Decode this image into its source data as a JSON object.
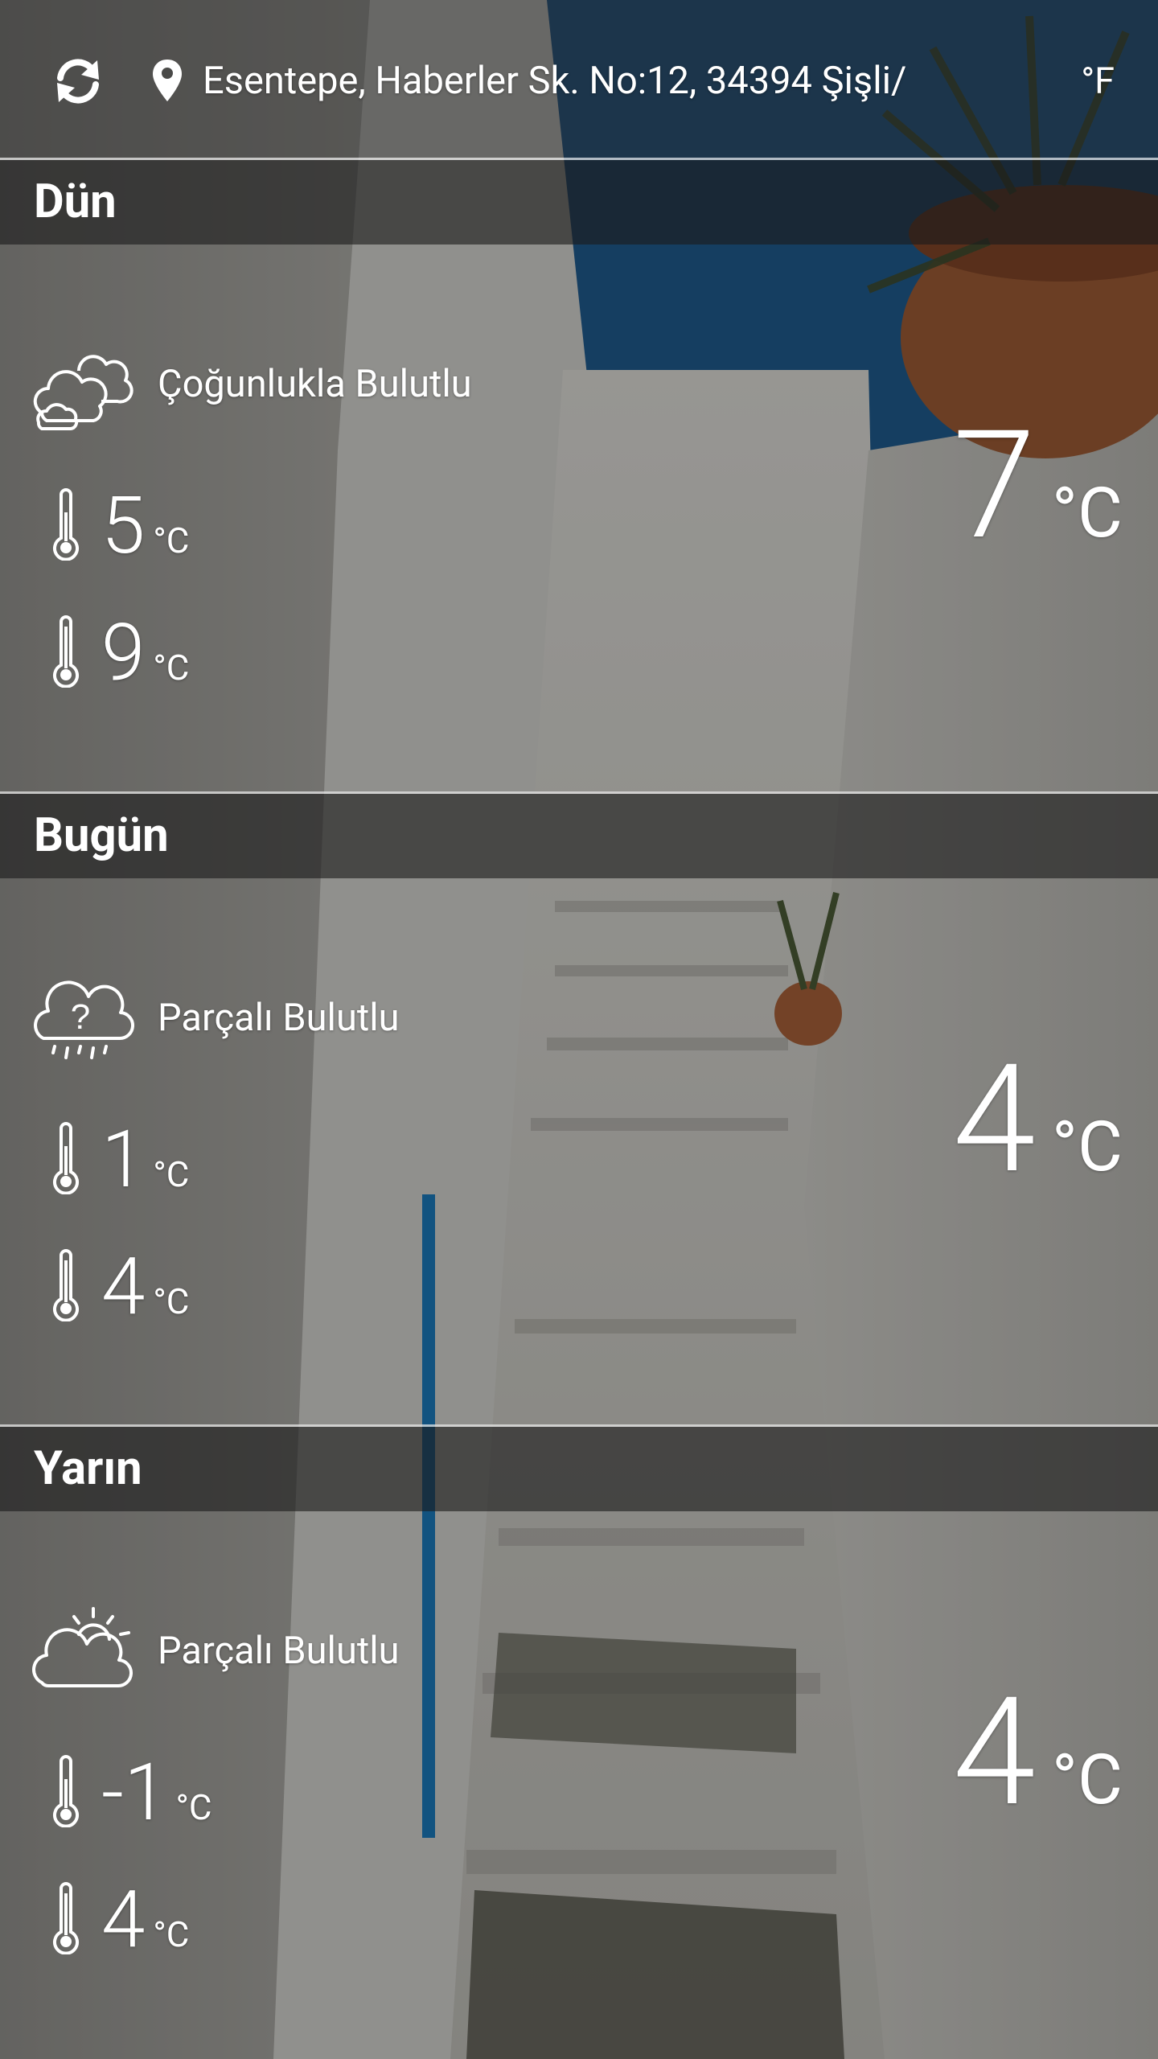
{
  "header": {
    "location": "Esentepe, Haberler Sk. No:12, 34394 Şişli/",
    "unit_toggle": "°F"
  },
  "days": [
    {
      "title": "Dün",
      "condition": "Çoğunlukla Bulutlu",
      "icon": "mostly-cloudy-icon",
      "low": "5",
      "high": "9",
      "current": "7",
      "unit": "°C"
    },
    {
      "title": "Bugün",
      "condition": "Parçalı Bulutlu",
      "icon": "cloud-question-rain-icon",
      "low": "1",
      "high": "4",
      "current": "4",
      "unit": "°C"
    },
    {
      "title": "Yarın",
      "condition": "Parçalı Bulutlu",
      "icon": "partly-cloudy-sun-icon",
      "low": "-1",
      "high": "4",
      "current": "4",
      "unit": "°C"
    }
  ]
}
